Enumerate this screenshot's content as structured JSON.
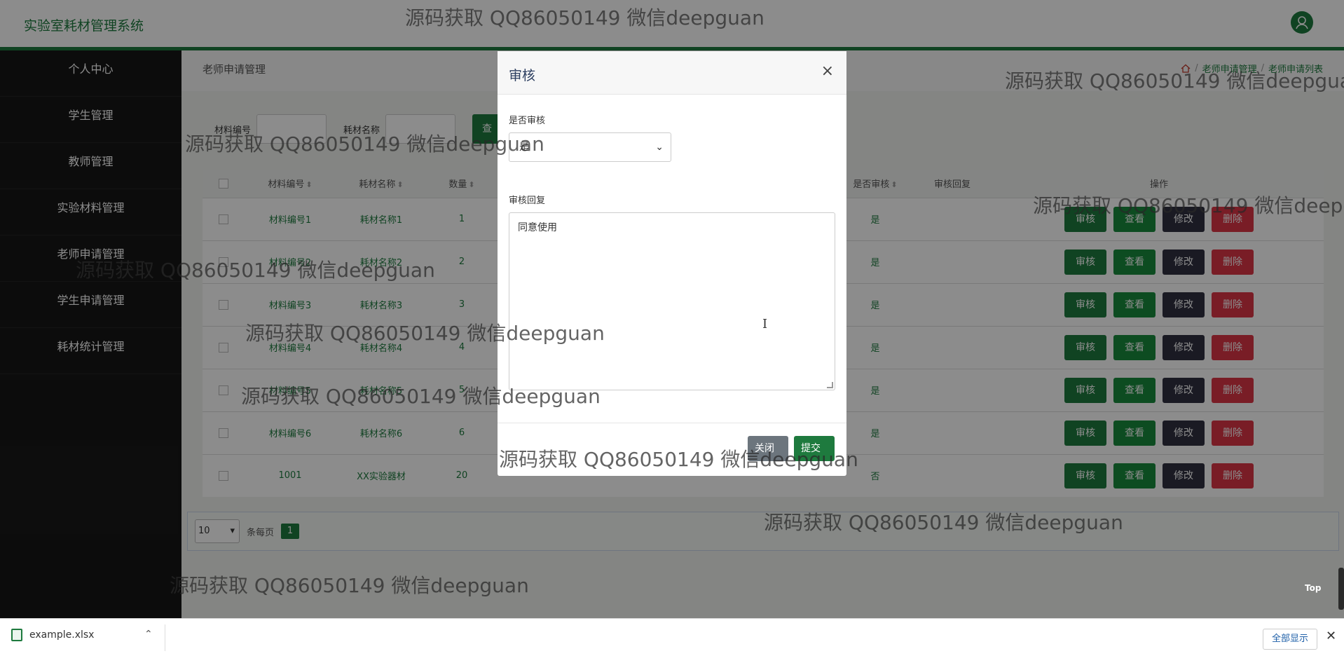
{
  "app": {
    "title": "实验室耗材管理系统"
  },
  "sidebar": {
    "items": [
      {
        "label": "个人中心"
      },
      {
        "label": "学生管理"
      },
      {
        "label": "教师管理"
      },
      {
        "label": "实验材料管理"
      },
      {
        "label": "老师申请管理"
      },
      {
        "label": "学生申请管理"
      },
      {
        "label": "耗材统计管理"
      }
    ]
  },
  "page": {
    "title": "老师申请管理",
    "breadcrumb": [
      "老师申请管理",
      "老师申请列表"
    ]
  },
  "search": {
    "label_code": "材料编号",
    "label_name": "耗材名称",
    "button": "查"
  },
  "table": {
    "headers": [
      "材料编号",
      "耗材名称",
      "数量",
      "是否审核",
      "审核回复",
      "操作"
    ],
    "rows": [
      {
        "code": "材料编号1",
        "name": "耗材名称1",
        "qty": "1",
        "audited": "是"
      },
      {
        "code": "材料编号2",
        "name": "耗材名称2",
        "qty": "2",
        "audited": "是"
      },
      {
        "code": "材料编号3",
        "name": "耗材名称3",
        "qty": "3",
        "audited": "是"
      },
      {
        "code": "材料编号4",
        "name": "耗材名称4",
        "qty": "4",
        "audited": "是"
      },
      {
        "code": "材料编号5",
        "name": "耗材名称5",
        "qty": "5",
        "audited": "是"
      },
      {
        "code": "材料编号6",
        "name": "耗材名称6",
        "qty": "6",
        "audited": "是"
      },
      {
        "code": "1001",
        "name": "XX实验器材",
        "qty": "20",
        "audited": "否"
      }
    ],
    "actions": {
      "audit": "审核",
      "view": "查看",
      "edit": "修改",
      "delete": "删除"
    }
  },
  "pager": {
    "page_size": "10",
    "per_page_label": "条每页",
    "current": "1"
  },
  "top_label": "Top",
  "modal": {
    "title": "审核",
    "close_symbol": "×",
    "field_audit_label": "是否审核",
    "field_audit_value": "是",
    "field_reply_label": "审核回复",
    "field_reply_value": "同意使用",
    "btn_close": "关闭",
    "btn_submit": "提交"
  },
  "download_bar": {
    "file": "example.xlsx",
    "show_all": "全部显示",
    "close_symbol": "✕"
  },
  "watermark": "源码获取 QQ86050149 微信deepguan"
}
